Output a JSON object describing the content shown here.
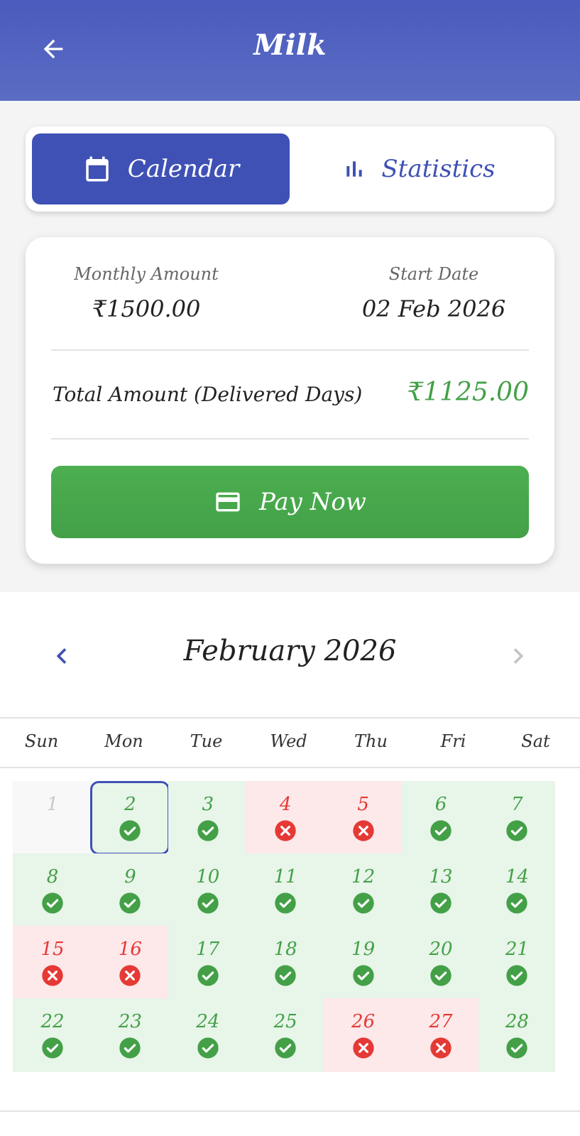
{
  "appbar": {
    "title": "Milk",
    "back_icon": "arrow-left-icon"
  },
  "tabs": {
    "calendar": {
      "label": "Calendar",
      "icon": "calendar-icon",
      "active": true
    },
    "statistics": {
      "label": "Statistics",
      "icon": "bar-chart-icon",
      "active": false
    }
  },
  "summary": {
    "monthly_amount_label": "Monthly Amount",
    "monthly_amount_value": "₹1500.00",
    "start_date_label": "Start Date",
    "start_date_value": "02 Feb 2026",
    "total_label": "Total Amount (Delivered Days)",
    "total_value": "₹1125.00",
    "pay_button_label": "Pay Now",
    "pay_icon": "credit-card-icon"
  },
  "calendar": {
    "month_title": "February 2026",
    "prev_icon": "chevron-left-icon",
    "next_icon": "chevron-right-icon",
    "weekdays": [
      "Sun",
      "Mon",
      "Tue",
      "Wed",
      "Thu",
      "Fri",
      "Sat"
    ],
    "days": [
      {
        "day": "1",
        "status": "empty"
      },
      {
        "day": "2",
        "status": "delivered",
        "selected": true
      },
      {
        "day": "3",
        "status": "delivered"
      },
      {
        "day": "4",
        "status": "missed"
      },
      {
        "day": "5",
        "status": "missed"
      },
      {
        "day": "6",
        "status": "delivered"
      },
      {
        "day": "7",
        "status": "delivered"
      },
      {
        "day": "8",
        "status": "delivered"
      },
      {
        "day": "9",
        "status": "delivered"
      },
      {
        "day": "10",
        "status": "delivered"
      },
      {
        "day": "11",
        "status": "delivered"
      },
      {
        "day": "12",
        "status": "delivered"
      },
      {
        "day": "13",
        "status": "delivered"
      },
      {
        "day": "14",
        "status": "delivered"
      },
      {
        "day": "15",
        "status": "missed"
      },
      {
        "day": "16",
        "status": "missed"
      },
      {
        "day": "17",
        "status": "delivered"
      },
      {
        "day": "18",
        "status": "delivered"
      },
      {
        "day": "19",
        "status": "delivered"
      },
      {
        "day": "20",
        "status": "delivered"
      },
      {
        "day": "21",
        "status": "delivered"
      },
      {
        "day": "22",
        "status": "delivered"
      },
      {
        "day": "23",
        "status": "delivered"
      },
      {
        "day": "24",
        "status": "delivered"
      },
      {
        "day": "25",
        "status": "delivered"
      },
      {
        "day": "26",
        "status": "missed"
      },
      {
        "day": "27",
        "status": "missed"
      },
      {
        "day": "28",
        "status": "delivered"
      }
    ]
  },
  "colors": {
    "primary": "#3f51b5",
    "appbar": "#4a5bbd",
    "delivered": "#43a047",
    "delivered_bg": "#e8f5e9",
    "missed": "#e53935",
    "missed_bg": "#fde8ea"
  }
}
